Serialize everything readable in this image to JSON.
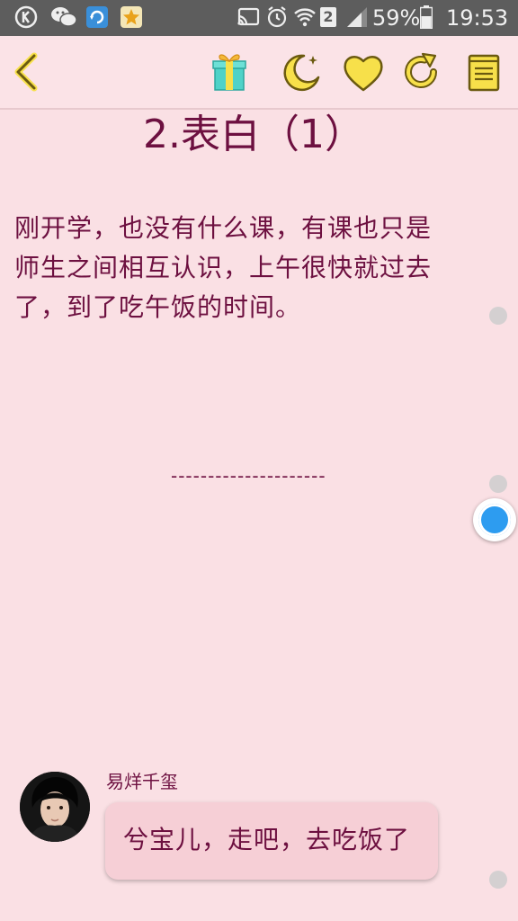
{
  "status_bar": {
    "battery_percent": "59%",
    "time": "19:53",
    "sim_badge": "2",
    "icons": [
      "k-app-icon",
      "wechat-icon",
      "sync-app-icon",
      "favorites-app-icon",
      "cast-icon",
      "alarm-icon",
      "wifi-icon",
      "sim2-icon",
      "signal-icon",
      "battery-icon"
    ]
  },
  "toolbar": {
    "icons": [
      "back-chevron-icon",
      "gift-icon",
      "moon-icon",
      "heart-icon",
      "refresh-icon",
      "book-icon"
    ],
    "accent_color": "#f7e04a"
  },
  "chapter": {
    "title": "2.表白（1）",
    "paragraph_lines": [
      "刚开学，也没有什么课，有课也只是",
      "师生之间相互认识，上午很快就过去",
      "了，到了吃午饭的时间。"
    ],
    "divider": "---------------------"
  },
  "dialogue": {
    "speaker": "易烊千玺",
    "message": "兮宝儿，走吧，去吃饭了"
  },
  "colors": {
    "background": "#fae0e4",
    "text": "#6d1040",
    "bubble": "#f6cfd6",
    "scroll_handle": "#2d9cf0"
  }
}
